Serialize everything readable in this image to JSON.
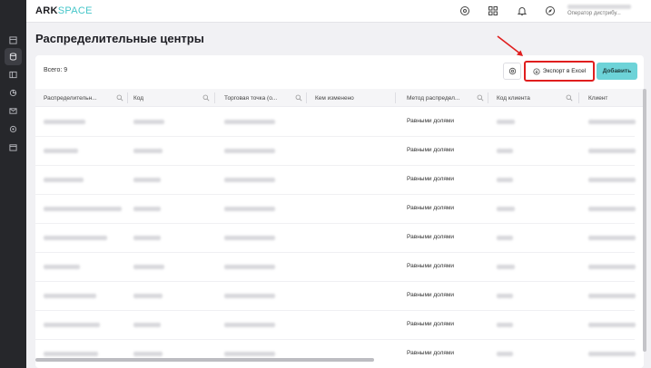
{
  "app": {
    "logo_main": "ARK",
    "logo_accent": "SPACE"
  },
  "header": {
    "user_role": "Оператор дистрибу..."
  },
  "page": {
    "title": "Распределительные центры"
  },
  "toolbar": {
    "total_label": "Всего: 9",
    "export_label": "Экспорт в Excel",
    "add_label": "Добавить"
  },
  "table": {
    "columns": [
      "Распределительн...",
      "Код",
      "Торговая точка (о...",
      "Кем изменено",
      "Метод распредел...",
      "Код клиента",
      "Клиент"
    ],
    "rows": [
      {
        "method": "Равными долями"
      },
      {
        "method": "Равными долями"
      },
      {
        "method": "Равными долями"
      },
      {
        "method": "Равными долями"
      },
      {
        "method": "Равными долями"
      },
      {
        "method": "Равными долями"
      },
      {
        "method": "Равными долями"
      },
      {
        "method": "Равными долями"
      },
      {
        "method": "Равными долями"
      }
    ]
  },
  "colors": {
    "sidebar": "#26272b",
    "accent": "#45c6c9",
    "add_button": "#6dd3d8",
    "highlight": "#e01e1e"
  }
}
